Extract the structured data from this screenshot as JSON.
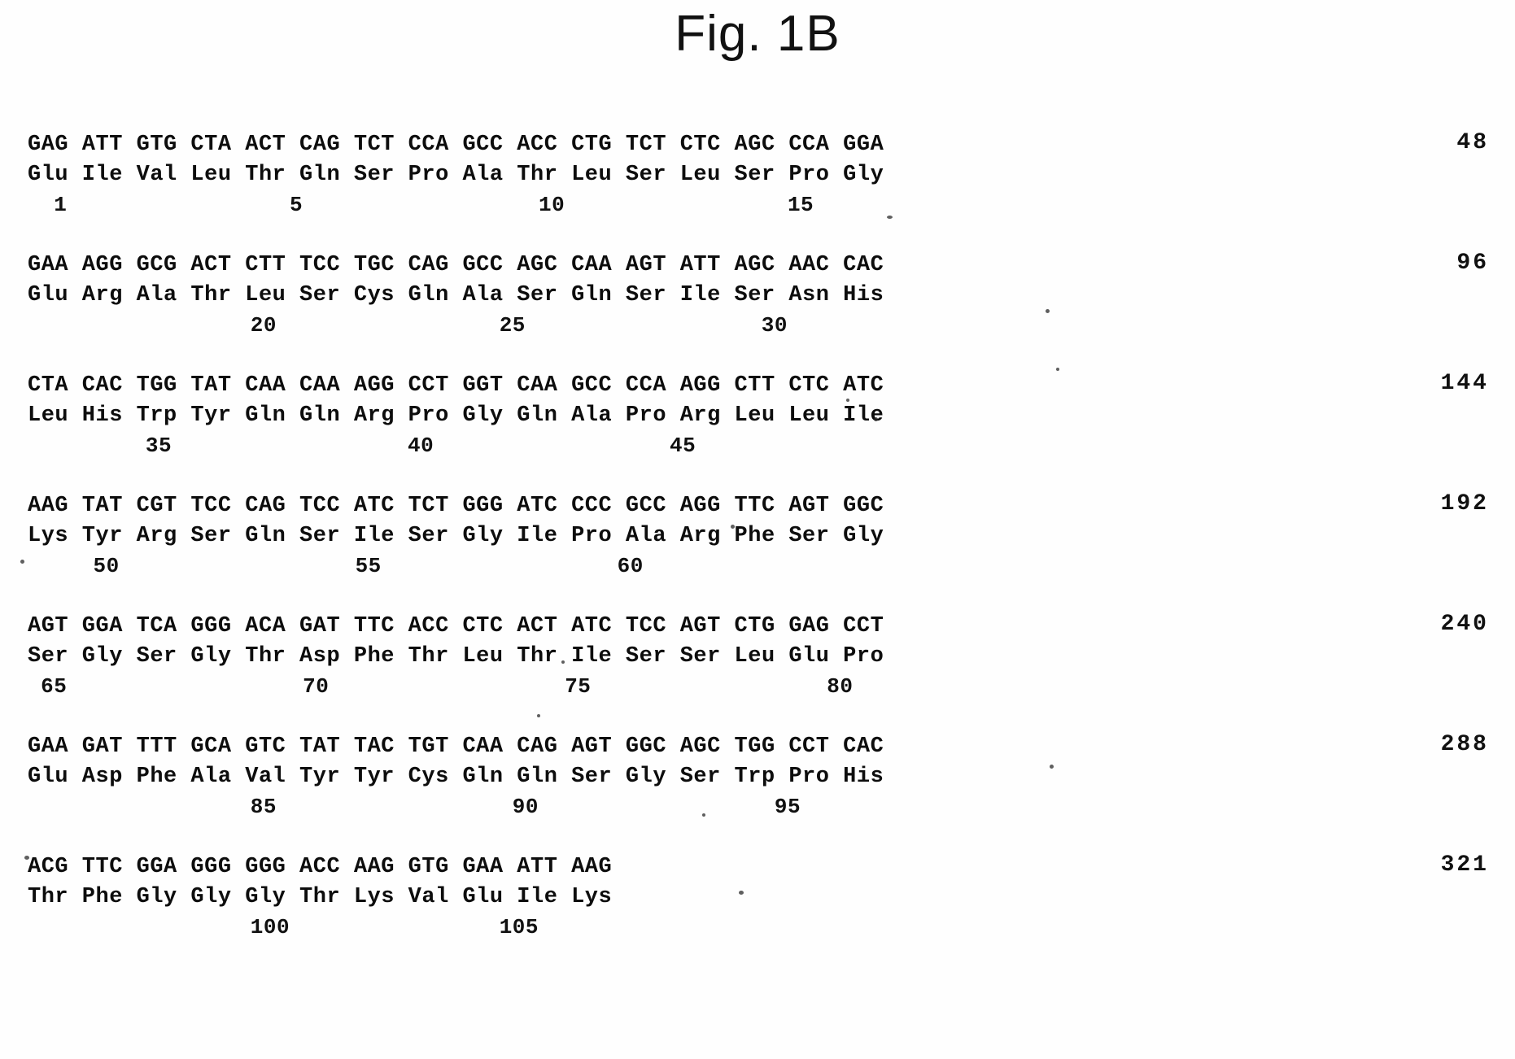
{
  "figure": {
    "title": "Fig. 1B"
  },
  "sequence_blocks": [
    {
      "dna": "GAG ATT GTG CTA ACT CAG TCT CCA GCC ACC CTG TCT CTC AGC CCA GGA",
      "protein": "Glu Ile Val Leu Thr Gln Ser Pro Ala Thr Leu Ser Leu Ser Pro Gly",
      "numbering": "  1                 5                  10                 15",
      "end_number": "48"
    },
    {
      "dna": "GAA AGG GCG ACT CTT TCC TGC CAG GCC AGC CAA AGT ATT AGC AAC CAC",
      "protein": "Glu Arg Ala Thr Leu Ser Cys Gln Ala Ser Gln Ser Ile Ser Asn His",
      "numbering": "                 20                 25                  30",
      "end_number": "96"
    },
    {
      "dna": "CTA CAC TGG TAT CAA CAA AGG CCT GGT CAA GCC CCA AGG CTT CTC ATC",
      "protein": "Leu His Trp Tyr Gln Gln Arg Pro Gly Gln Ala Pro Arg Leu Leu Ile",
      "numbering": "         35                  40                  45",
      "end_number": "144"
    },
    {
      "dna": "AAG TAT CGT TCC CAG TCC ATC TCT GGG ATC CCC GCC AGG TTC AGT GGC",
      "protein": "Lys Tyr Arg Ser Gln Ser Ile Ser Gly Ile Pro Ala Arg Phe Ser Gly",
      "numbering": "     50                  55                  60",
      "end_number": "192"
    },
    {
      "dna": "AGT GGA TCA GGG ACA GAT TTC ACC CTC ACT ATC TCC AGT CTG GAG CCT",
      "protein": "Ser Gly Ser Gly Thr Asp Phe Thr Leu Thr Ile Ser Ser Leu Glu Pro",
      "numbering": " 65                  70                  75                  80",
      "end_number": "240"
    },
    {
      "dna": "GAA GAT TTT GCA GTC TAT TAC TGT CAA CAG AGT GGC AGC TGG CCT CAC",
      "protein": "Glu Asp Phe Ala Val Tyr Tyr Cys Gln Gln Ser Gly Ser Trp Pro His",
      "numbering": "                 85                  90                  95",
      "end_number": "288"
    },
    {
      "dna": "ACG TTC GGA GGG GGG ACC AAG GTG GAA ATT AAG",
      "protein": "Thr Phe Gly Gly Gly Thr Lys Val Glu Ile Lys",
      "numbering": "                 100                105",
      "end_number": "321"
    }
  ]
}
